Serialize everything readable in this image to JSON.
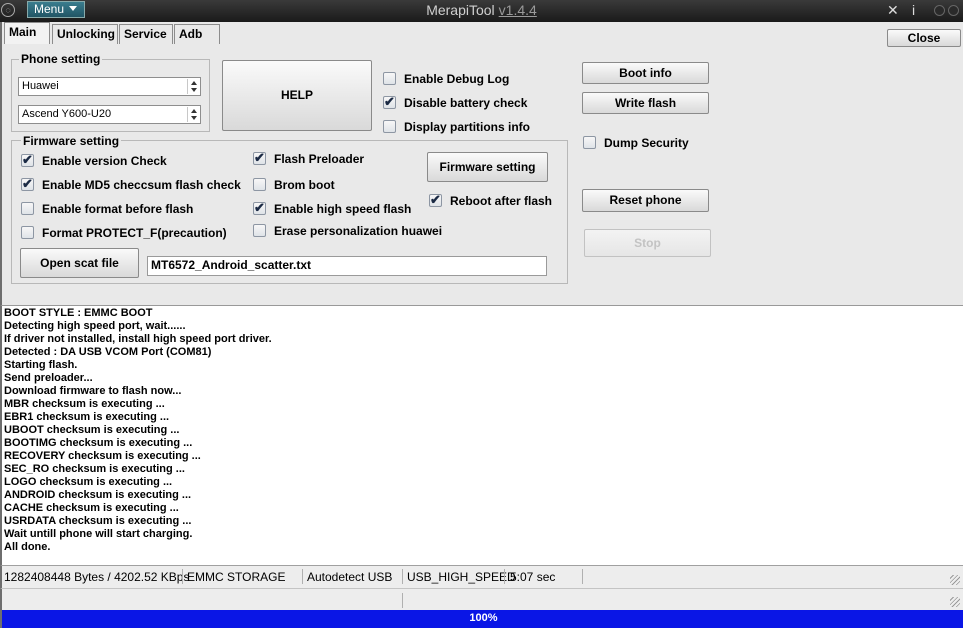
{
  "titlebar": {
    "menu_label": "Menu",
    "app_name": "MerapiTool",
    "version": "v1.4.4"
  },
  "tabs": [
    "Main",
    "Unlocking",
    "Service",
    "Adb"
  ],
  "close_label": "Close",
  "phone_setting": {
    "legend": "Phone setting",
    "brand": "Huawei",
    "model": "Ascend Y600-U20"
  },
  "help_label": "HELP",
  "options": {
    "debug_log": {
      "label": "Enable Debug Log",
      "checked": false
    },
    "disable_battery": {
      "label": "Disable battery check",
      "checked": true
    },
    "display_partitions": {
      "label": "Display partitions info",
      "checked": false
    }
  },
  "firmware": {
    "legend": "Firmware setting",
    "version_check": {
      "label": "Enable version Check",
      "checked": true
    },
    "md5_check": {
      "label": "Enable MD5 checcsum flash check",
      "checked": true
    },
    "format_before": {
      "label": "Enable format before flash",
      "checked": false
    },
    "format_protect": {
      "label": "Format PROTECT_F(precaution)",
      "checked": false
    },
    "flash_preloader": {
      "label": "Flash Preloader",
      "checked": true
    },
    "brom_boot": {
      "label": "Brom boot",
      "checked": false
    },
    "high_speed": {
      "label": "Enable high speed flash",
      "checked": true
    },
    "erase_personalization": {
      "label": "Erase personalization huawei",
      "checked": false
    },
    "reboot_after": {
      "label": "Reboot after flash",
      "checked": true
    },
    "firmware_button": "Firmware setting",
    "open_scat_button": "Open scat file",
    "scatter_file": "MT6572_Android_scatter.txt"
  },
  "actions": {
    "boot_info": "Boot info",
    "write_flash": "Write flash",
    "dump_security": {
      "label": "Dump Security",
      "checked": false
    },
    "reset_phone": "Reset phone",
    "stop": "Stop"
  },
  "log": [
    "BOOT STYLE : EMMC BOOT",
    "Detecting high speed port, wait......",
    "If driver not installed, install high speed port driver.",
    "Detected : DA USB VCOM Port (COM81)",
    "Starting flash.",
    "Send preloader...",
    "Download firmware to flash now...",
    "MBR checksum is executing ...",
    "EBR1 checksum is executing ...",
    "UBOOT checksum is executing ...",
    "BOOTIMG checksum is executing ...",
    "RECOVERY checksum is executing ...",
    "SEC_RO checksum is executing ...",
    "LOGO checksum is executing ...",
    "ANDROID checksum is executing ...",
    "CACHE checksum is executing ...",
    "USRDATA checksum is executing ...",
    "Wait untill phone will start charging.",
    "All done."
  ],
  "status": {
    "bytes": "1282408448 Bytes / 4202.52 KBps",
    "storage": "EMMC STORAGE",
    "usb_mode": "Autodetect USB",
    "speed": "USB_HIGH_SPEED",
    "time": "5:07 sec"
  },
  "progress": {
    "percent": 100,
    "label": "100%"
  },
  "icons": {
    "title_circle": "circle-icon",
    "tools": "tools-icon",
    "info": "info-icon",
    "minimize": "minimize-icon",
    "close_window": "close-window-icon"
  }
}
